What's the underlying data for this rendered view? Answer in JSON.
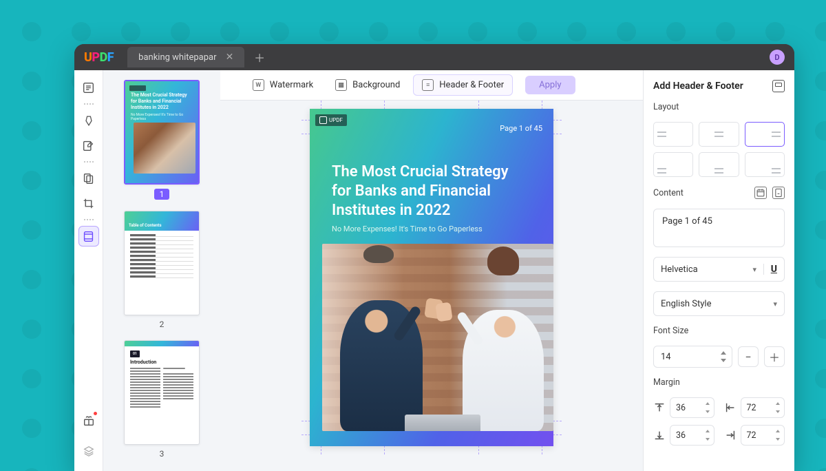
{
  "app": {
    "logo": "UPDF",
    "avatar_initial": "D"
  },
  "tab": {
    "title": "banking whitepapar"
  },
  "topbar": {
    "watermark": "Watermark",
    "background": "Background",
    "header_footer": "Header & Footer",
    "apply": "Apply"
  },
  "thumbnails": [
    {
      "num": "1",
      "title": "The Most Crucial Strategy for Banks and Financial Institutes in 2022",
      "sub": "No More Expenses! It's Time to Go Paperless"
    },
    {
      "num": "2",
      "toc_title": "Table of Contents"
    },
    {
      "num": "3",
      "badge": "01",
      "title": "Introduction"
    }
  ],
  "document": {
    "header_text": "Page 1 of 45",
    "title_l1": "The Most Crucial Strategy",
    "title_l2": "for Banks and Financial",
    "title_l3": "Institutes in 2022",
    "subtitle": "No More Expenses! It's Time to Go Paperless",
    "chip": "UPDF"
  },
  "panel": {
    "title": "Add Header & Footer",
    "layout_label": "Layout",
    "content_label": "Content",
    "content_value": "Page 1 of 45",
    "font_family": "Helvetica",
    "number_style": "English Style",
    "font_size_label": "Font Size",
    "font_size": "14",
    "margin_label": "Margin",
    "margin_top": "36",
    "margin_bottom": "36",
    "margin_left": "72",
    "margin_right": "72"
  }
}
